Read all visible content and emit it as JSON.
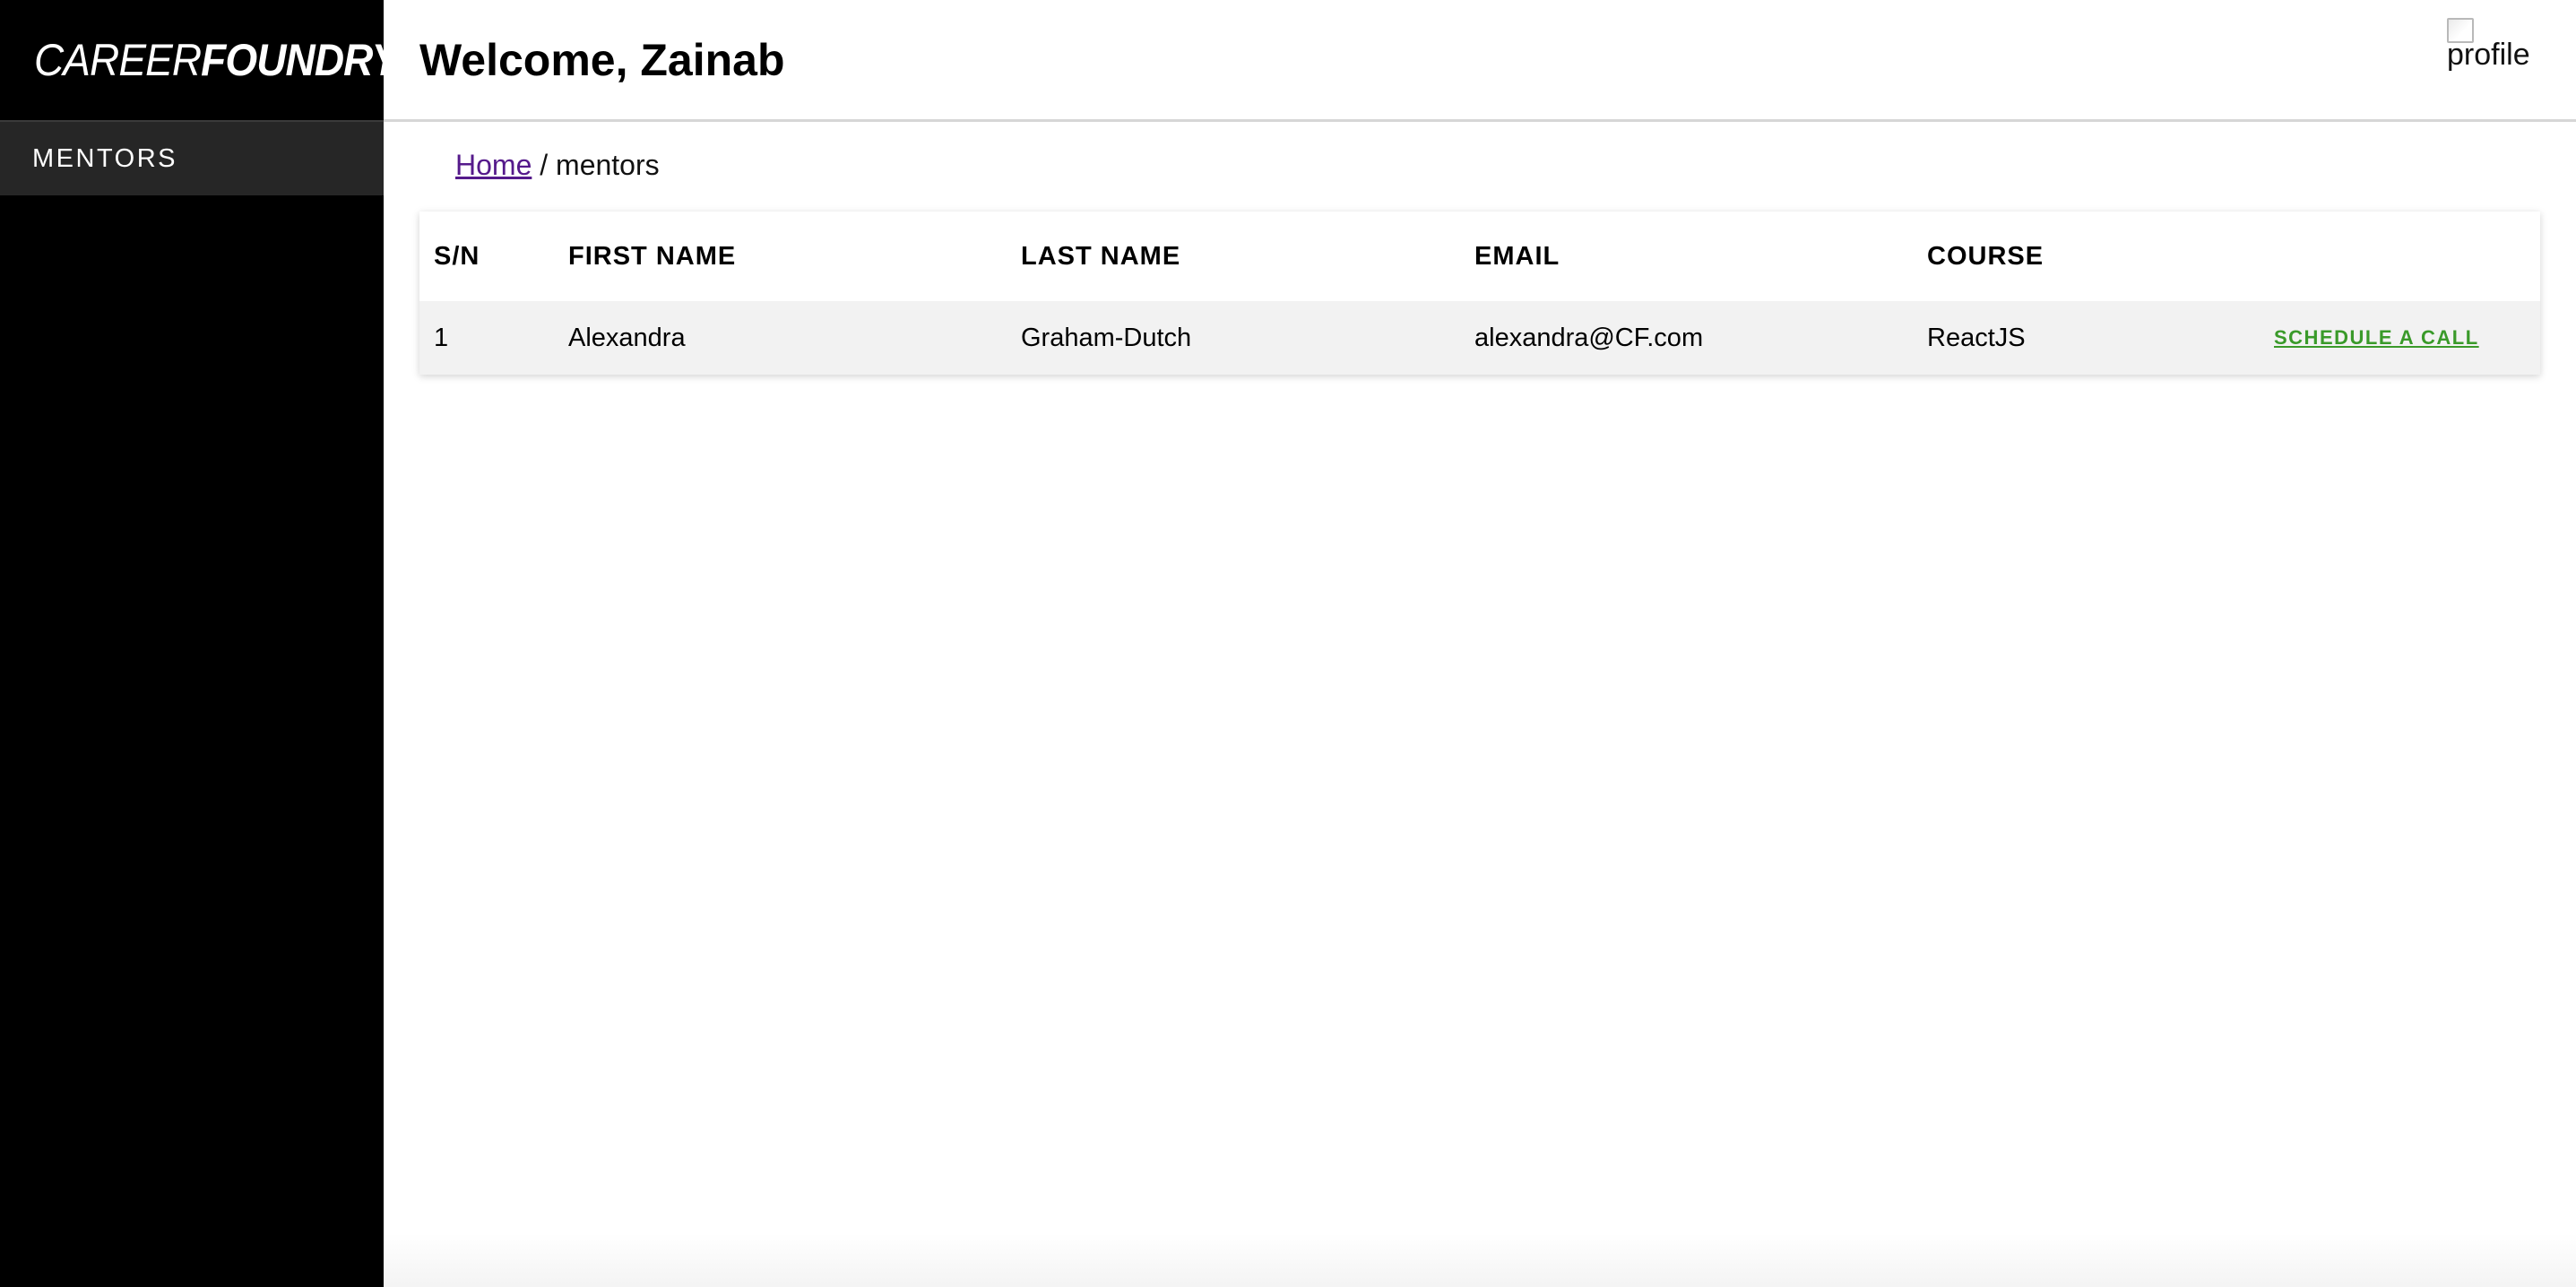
{
  "app": {
    "logo_light": "CAREER",
    "logo_bold": "FOUNDRY"
  },
  "sidebar": {
    "items": [
      {
        "label": "MENTORS"
      }
    ]
  },
  "header": {
    "welcome": "Welcome, Zainab",
    "profile_alt": "profile"
  },
  "breadcrumb": {
    "home": "Home",
    "separator": " / ",
    "current": "mentors"
  },
  "table": {
    "columns": [
      "S/N",
      "FIRST NAME",
      "LAST NAME",
      "EMAIL",
      "COURSE",
      ""
    ],
    "rows": [
      {
        "sn": "1",
        "first_name": "Alexandra",
        "last_name": "Graham-Dutch",
        "email": "alexandra@CF.com",
        "course": "ReactJS",
        "action": "SCHEDULE A CALL"
      }
    ]
  },
  "colors": {
    "sidebar_bg": "#000000",
    "nav_active_bg": "#262626",
    "action_green": "#3a9a2a",
    "link_visited": "#551a8b"
  }
}
